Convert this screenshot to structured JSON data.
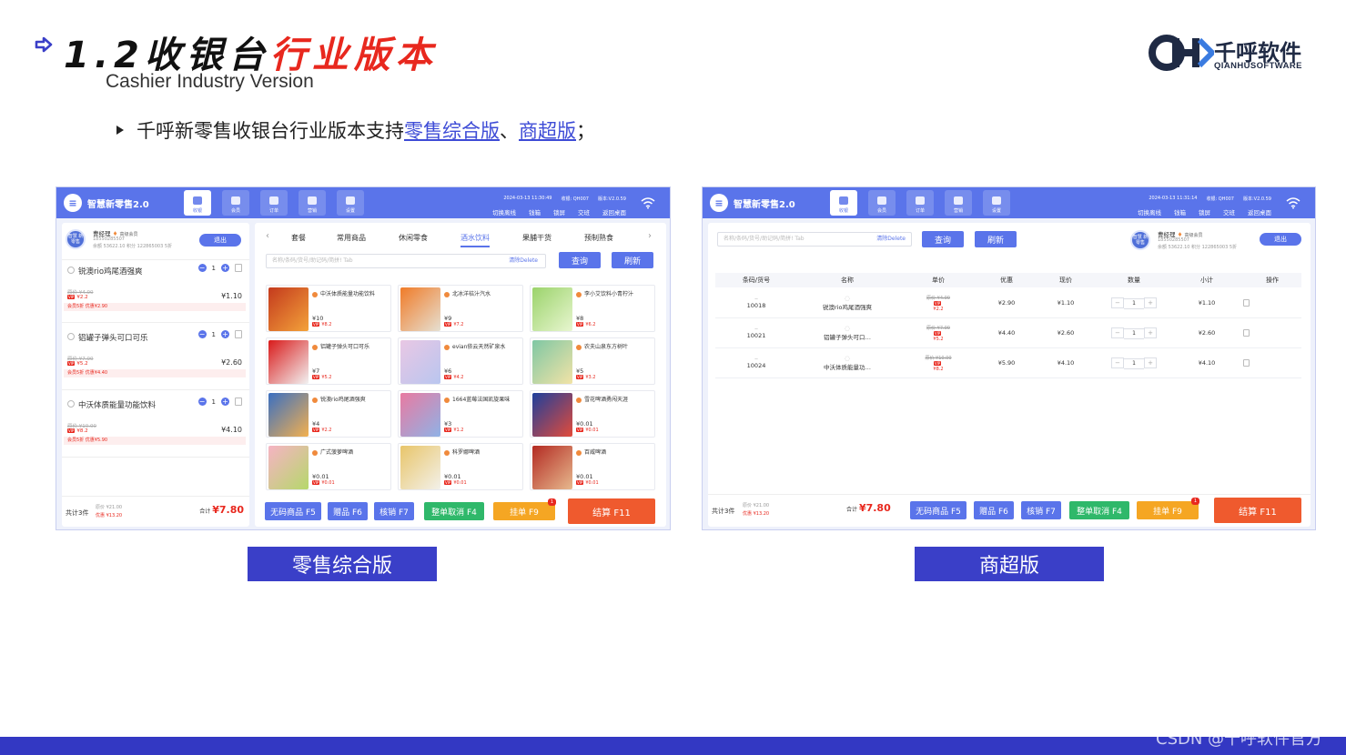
{
  "slide": {
    "title_prefix": "1.2收银台",
    "title_highlight": "行业版本",
    "subtitle": "Cashier Industry Version",
    "logo_cn": "千呼软件",
    "logo_en": "QIANHUSOFTWARE",
    "bullet_text": "千呼新零售收银台行业版本支持",
    "bullet_link1": "零售综合版",
    "bullet_sep": "、",
    "bullet_link2": "商超版",
    "bullet_end": "；",
    "label_left": "零售综合版",
    "label_right": "商超版",
    "watermark": "CSDN @千呼软件官方",
    "colors": {
      "accent": "#3a3fc8",
      "highlight": "#e8281e",
      "app_blue": "#5a74ea"
    }
  },
  "app": {
    "logo_glyph": "≡",
    "title": "智慧新零售2.0",
    "nav": [
      "收银",
      "会员",
      "订单",
      "营销",
      "设置"
    ],
    "info1": "2024-03-13 11:30:49",
    "info1b": "2024-03-13 11:31:14",
    "info2": "收银: QH007",
    "info3": "版本:V2.0.59",
    "links": [
      "切换离线",
      "钱箱",
      "锁屏",
      "交班",
      "返回桌面"
    ],
    "user_name": "曹经理",
    "user_level": "高级会员",
    "user_phone": "18550285507",
    "user_stats": "余额 53622.10  积分 122865003  5折",
    "avatar_text": "智慧 新零售",
    "exit": "退出",
    "search_placeholder": "名称/条码/货号/助记码/简拼! Tab",
    "clear": "清除Delete",
    "query": "查询",
    "refresh": "刷新"
  },
  "retail": {
    "cart": [
      {
        "name": "锐澳rio鸡尾酒强爽",
        "qty": "1",
        "orig": "原价 ¥4.00",
        "vip": "¥2.2",
        "sub": "¥1.10",
        "disc": "会员5折    优惠¥2.90"
      },
      {
        "name": "铝罐子弹头可口可乐",
        "qty": "1",
        "orig": "原价 ¥7.00",
        "vip": "¥5.2",
        "sub": "¥2.60",
        "disc": "会员5折    优惠¥4.40"
      },
      {
        "name": "中沃体质能量功能饮料",
        "qty": "1",
        "orig": "原价 ¥10.00",
        "vip": "¥8.2",
        "sub": "¥4.10",
        "disc": "会员5折    优惠¥5.90"
      }
    ],
    "count_label": "共计3件",
    "orig_total": "原价 ¥21.00",
    "disc_total": "优惠 ¥13.20",
    "total_label": "合计",
    "total": "¥7.80",
    "categories": [
      "套餐",
      "常用商品",
      "休闲零食",
      "酒水饮料",
      "果脯干货",
      "预制熟食"
    ],
    "active_category": "酒水饮料",
    "products": [
      {
        "name": "中沃体质能量功能饮料",
        "price": "¥10",
        "vip": "¥8.2",
        "c1": "#c43a1d",
        "c2": "#f3a23a"
      },
      {
        "name": "北冰洋桔汁汽水",
        "price": "¥9",
        "vip": "¥7.2",
        "c1": "#f07b28",
        "c2": "#e6e0d2"
      },
      {
        "name": "李小艾饮料小青柠汁",
        "price": "¥8",
        "vip": "¥6.2",
        "c1": "#9bd36b",
        "c2": "#e8f6d0"
      },
      {
        "name": "铝罐子弹头可口可乐",
        "price": "¥7",
        "vip": "¥5.2",
        "c1": "#d91a1a",
        "c2": "#f2f2f2"
      },
      {
        "name": "evian依云天然矿泉水",
        "price": "¥6",
        "vip": "¥4.2",
        "c1": "#e9c7e4",
        "c2": "#b9c6ef"
      },
      {
        "name": "农夫山泉东方树叶",
        "price": "¥5",
        "vip": "¥3.2",
        "c1": "#7fc7a4",
        "c2": "#f2e3a6"
      },
      {
        "name": "锐澳rio鸡尾酒强爽",
        "price": "¥4",
        "vip": "¥2.2",
        "c1": "#3a6fc1",
        "c2": "#f3b04f"
      },
      {
        "name": "1664蓝莓法国凯旋果味",
        "price": "¥3",
        "vip": "¥1.2",
        "c1": "#e97aa1",
        "c2": "#8fb2e6"
      },
      {
        "name": "雪花啤酒勇闯天涯",
        "price": "¥0.01",
        "vip": "¥0.01",
        "c1": "#1d3f9c",
        "c2": "#e24b3a"
      },
      {
        "name": "广式菠萝啤酒",
        "price": "¥0.01",
        "vip": "¥0.01",
        "c1": "#f6b3c4",
        "c2": "#b5d86a"
      },
      {
        "name": "科罗娜啤酒",
        "price": "¥0.01",
        "vip": "¥0.01",
        "c1": "#e8c56a",
        "c2": "#f3f1ea"
      },
      {
        "name": "百威啤酒",
        "price": "¥0.01",
        "vip": "¥0.01",
        "c1": "#b32a22",
        "c2": "#e7b98e"
      }
    ]
  },
  "market": {
    "headers": [
      "条码/货号",
      "名称",
      "单价",
      "优惠",
      "现价",
      "数量",
      "小计",
      "操作"
    ],
    "rows": [
      {
        "code": "10018",
        "name": "锐澳rio鸡尾酒强爽",
        "orig": "原价 ¥4.00",
        "vip": "¥2.2",
        "disc": "¥2.90",
        "now": "¥1.10",
        "qty": "1",
        "sub": "¥1.10"
      },
      {
        "code": "10021",
        "name": "铝罐子弹头可口…",
        "orig": "原价 ¥7.00",
        "vip": "¥5.2",
        "disc": "¥4.40",
        "now": "¥2.60",
        "qty": "1",
        "sub": "¥2.60"
      },
      {
        "code": "10024",
        "name": "中沃体质能量功…",
        "orig": "原价 ¥10.00",
        "vip": "¥8.2",
        "disc": "¥5.90",
        "now": "¥4.10",
        "qty": "1",
        "sub": "¥4.10"
      }
    ],
    "dash": "--"
  },
  "buttons": {
    "f5": "无码商品 F5",
    "f6": "赠品 F6",
    "f7": "核销 F7",
    "f4": "整单取消 F4",
    "f9": "挂单 F9",
    "f9_badge": "1",
    "f11": "结算 F11"
  }
}
